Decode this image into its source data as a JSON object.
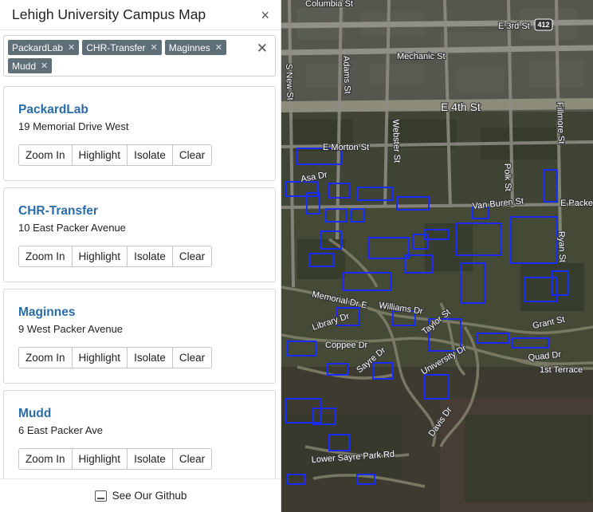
{
  "app": {
    "title": "Lehigh University Campus Map",
    "close_icon": "×"
  },
  "selection": {
    "tags": [
      {
        "label": "PackardLab"
      },
      {
        "label": "CHR-Transfer"
      },
      {
        "label": "Maginnes"
      },
      {
        "label": "Mudd"
      }
    ],
    "tag_remove_icon": "✕",
    "clear_all_icon": "✕"
  },
  "buildings": [
    {
      "name": "PackardLab",
      "address": "19 Memorial Drive West"
    },
    {
      "name": "CHR-Transfer",
      "address": "10 East Packer Avenue"
    },
    {
      "name": "Maginnes",
      "address": "9 West Packer Avenue"
    },
    {
      "name": "Mudd",
      "address": "6 East Packer Ave"
    }
  ],
  "card_actions": {
    "zoom_in": "Zoom In",
    "highlight": "Highlight",
    "isolate": "Isolate",
    "clear": "Clear"
  },
  "footer": {
    "link_label": "See Our Github",
    "icon": "laptop-icon"
  },
  "map": {
    "route_shield": "412",
    "street_labels": [
      "Columbia St",
      "E 3rd St",
      "Mechanic St",
      "E 4th St",
      "E Morton St",
      "Asa Dr",
      "Van Buren St",
      "E Packer",
      "Memorial Dr E",
      "Williams Dr",
      "Library Dr",
      "Coppee Dr",
      "Sayre Dr",
      "Taylor St",
      "University Dr",
      "Grant St",
      "Quad Dr",
      "1st Terrace",
      "Lower Sayre Park Rd",
      "Davis Dr",
      "Adams St",
      "Webster St",
      "Polk St",
      "Fillmore St",
      "Ryan St",
      "S New St"
    ],
    "building_outline_color": "#1a2bff"
  }
}
